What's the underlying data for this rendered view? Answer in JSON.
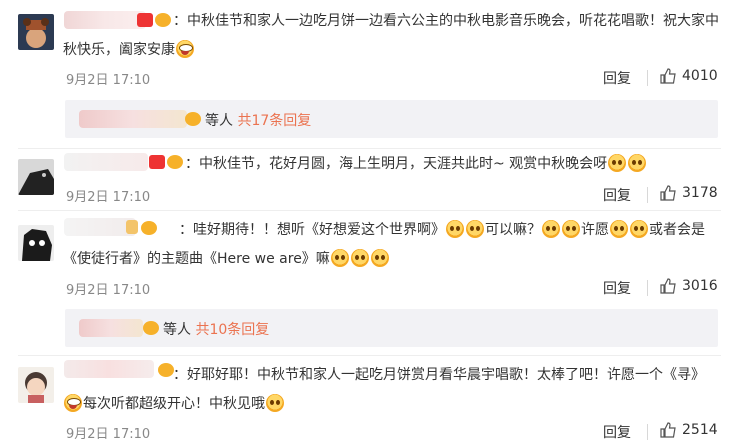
{
  "comments": [
    {
      "text": "：中秋佳节和家人一边吃月饼一边看六公主的中秋电影音乐晚会，听花花唱歌！祝大家中秋快乐，阖家安康",
      "time": "9月2日 17:10",
      "reply_label": "回复",
      "likes": "4010",
      "replies_summary": {
        "prefix": "等人",
        "link": "共17条回复"
      }
    },
    {
      "text": "：中秋佳节，花好月圆，海上生明月，天涯共此时~ 观赏中秋晚会呀",
      "time": "9月2日 17:10",
      "reply_label": "回复",
      "likes": "3178"
    },
    {
      "text_a": "：哇好期待！！想听《好想爱这个世界啊》",
      "text_b": "可以嘛？",
      "text_c": "许愿",
      "text_d": "或者会是《使徒行者》的主题曲《Here we are》嘛",
      "time": "9月2日 17:10",
      "reply_label": "回复",
      "likes": "3016",
      "replies_summary": {
        "prefix": "等人",
        "link": "共10条回复"
      }
    },
    {
      "text_a": "：好耶好耶！中秋节和家人一起吃月饼赏月看华晨宇唱歌！太棒了吧！许愿一个《寻》",
      "text_b": "每次听都超级开心！中秋见哦",
      "time": "9月2日 17:10",
      "reply_label": "回复",
      "likes": "2514"
    }
  ],
  "icons": {
    "like": "thumbs-up-icon",
    "emoji": "emoji-face-icon",
    "vip": "vip-badge-icon"
  },
  "colors": {
    "link": "#eb7350",
    "time": "#888888",
    "panel": "#f2f2f5"
  }
}
